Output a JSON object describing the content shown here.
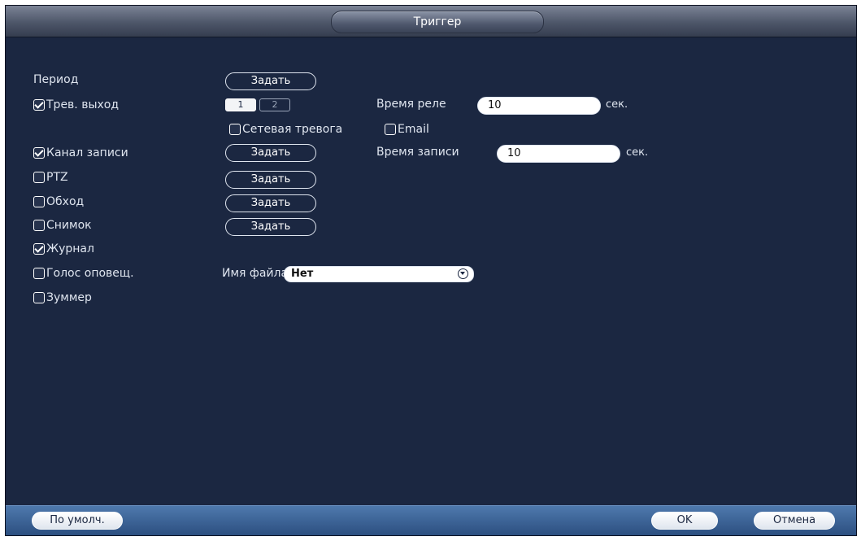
{
  "window": {
    "title": "Триггер"
  },
  "rows": {
    "period": {
      "label": "Период",
      "button": "Задать"
    },
    "alarm_out": {
      "label": "Трев. выход",
      "checked": true,
      "channels": [
        "1",
        "2"
      ],
      "relay_time_label": "Время реле",
      "relay_time_value": "10",
      "unit": "сек."
    },
    "net_alarm": {
      "label": "Сетевая тревога",
      "checked": false
    },
    "email": {
      "label": "Email",
      "checked": false
    },
    "record_channel": {
      "label": "Канал записи",
      "checked": true,
      "button": "Задать",
      "record_time_label": "Время записи",
      "record_time_value": "10",
      "unit": "сек."
    },
    "ptz": {
      "label": "PTZ",
      "checked": false,
      "button": "Задать"
    },
    "tour": {
      "label": "Обход",
      "checked": false,
      "button": "Задать"
    },
    "snapshot": {
      "label": "Снимок",
      "checked": false,
      "button": "Задать"
    },
    "log": {
      "label": "Журнал",
      "checked": true
    },
    "voice": {
      "label": "Голос оповещ.",
      "checked": false,
      "file_label": "Имя файла",
      "file_value": "Нет"
    },
    "buzzer": {
      "label": "Зуммер",
      "checked": false
    }
  },
  "footer": {
    "default_label": "По умолч.",
    "ok_label": "OK",
    "cancel_label": "Отмена"
  },
  "colors": {
    "background": "#1b2741",
    "footer": "#3a649a",
    "text": "#dfe5ef"
  }
}
